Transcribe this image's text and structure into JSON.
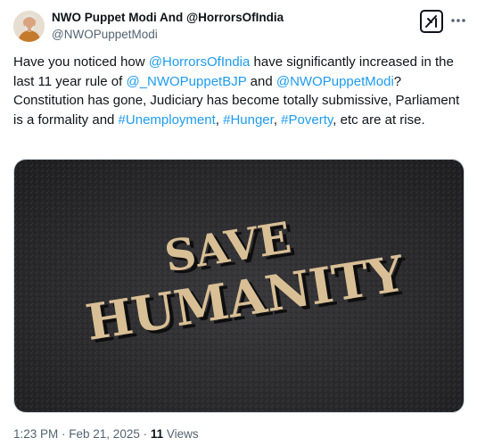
{
  "author": {
    "display_name": "NWO Puppet Modi And @HorrorsOfIndia",
    "handle": "@NWOPuppetModi"
  },
  "icons": {
    "avatar": "profile-avatar",
    "grok": "grok-icon",
    "more": "more-icon"
  },
  "tweet": {
    "segments": [
      {
        "type": "text",
        "value": "Have you noticed how "
      },
      {
        "type": "link",
        "value": "@HorrorsOfIndia"
      },
      {
        "type": "text",
        "value": " have significantly increased in the last 11 year rule of "
      },
      {
        "type": "link",
        "value": "@_NWOPuppetBJP"
      },
      {
        "type": "text",
        "value": " and "
      },
      {
        "type": "link",
        "value": "@NWOPuppetModi"
      },
      {
        "type": "text",
        "value": "? Constitution has gone, Judiciary has become totally submissive, Parliament is a formality and "
      },
      {
        "type": "link",
        "value": "#Unemployment"
      },
      {
        "type": "text",
        "value": ", "
      },
      {
        "type": "link",
        "value": "#Hunger"
      },
      {
        "type": "text",
        "value": ", "
      },
      {
        "type": "link",
        "value": "#Poverty"
      },
      {
        "type": "text",
        "value": ", etc are at rise."
      }
    ]
  },
  "media": {
    "line1": "SAVE",
    "line2": "HUMANITY",
    "colors": {
      "background": "#2b2b2d",
      "letters": "#d9bf95",
      "shadow": "#0e0e0e"
    }
  },
  "meta": {
    "time": "1:23 PM",
    "date": "Feb 21, 2025",
    "separator": " · ",
    "views_count": "11",
    "views_label": "Views"
  },
  "colors": {
    "link": "#1d9bf0",
    "secondary": "#536471",
    "text": "#0f1419",
    "border": "#cfd9de"
  }
}
